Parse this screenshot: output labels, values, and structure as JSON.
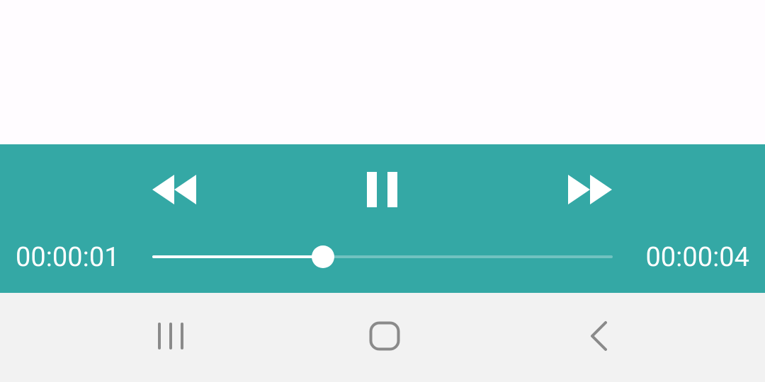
{
  "player": {
    "elapsed": "00:00:01",
    "total": "00:00:04",
    "progress_fraction": 0.37,
    "accent_color": "#34a8a5",
    "controls": {
      "rewind_icon": "rewind-icon",
      "pause_icon": "pause-icon",
      "fast_forward_icon": "fast-forward-icon"
    }
  },
  "navigation_bar": {
    "recents_icon": "recents-icon",
    "home_icon": "home-icon",
    "back_icon": "back-icon",
    "background_color": "#f2f2f2"
  }
}
